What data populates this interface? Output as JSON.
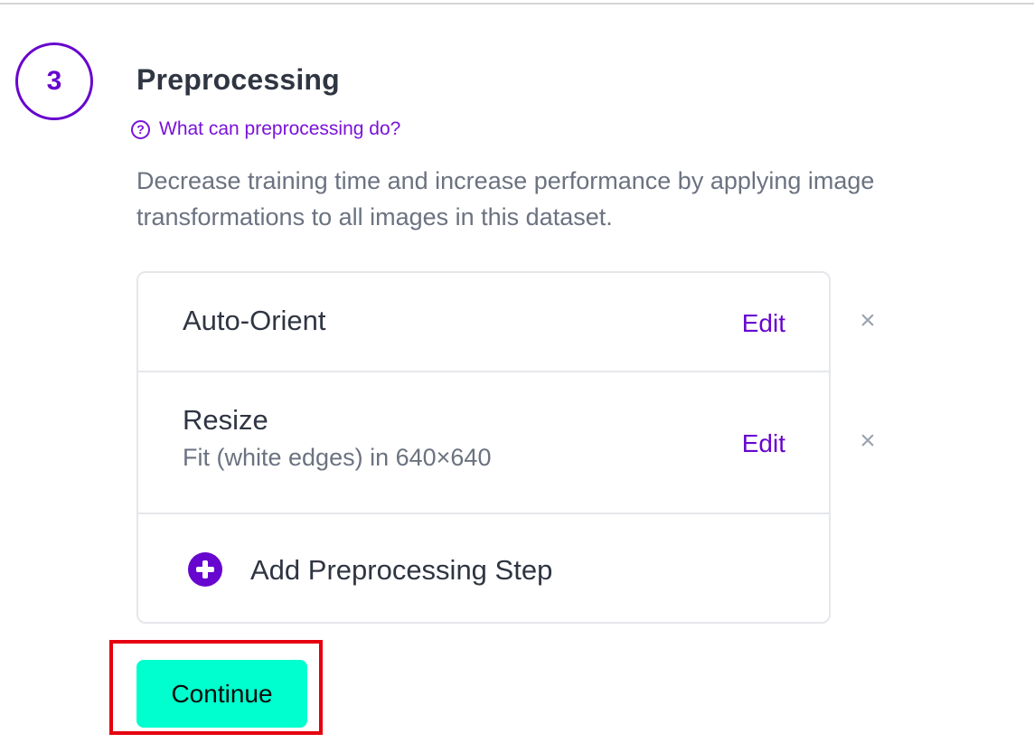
{
  "step": {
    "number": "3",
    "title": "Preprocessing",
    "help_link": "What can preprocessing do?",
    "description": "Decrease training time and increase performance by applying image transformations to all images in this dataset."
  },
  "preprocessing_steps": [
    {
      "name": "Auto-Orient",
      "detail": "",
      "edit_label": "Edit",
      "remove_icon": "close-icon"
    },
    {
      "name": "Resize",
      "detail": "Fit (white edges) in 640×640",
      "edit_label": "Edit",
      "remove_icon": "close-icon"
    }
  ],
  "add_step": {
    "label": "Add Preprocessing Step",
    "icon": "plus-circle-icon"
  },
  "continue_button": {
    "label": "Continue"
  },
  "colors": {
    "accent": "#6706ce",
    "continue_bg": "#00ffce",
    "highlight": "#e5000f"
  }
}
